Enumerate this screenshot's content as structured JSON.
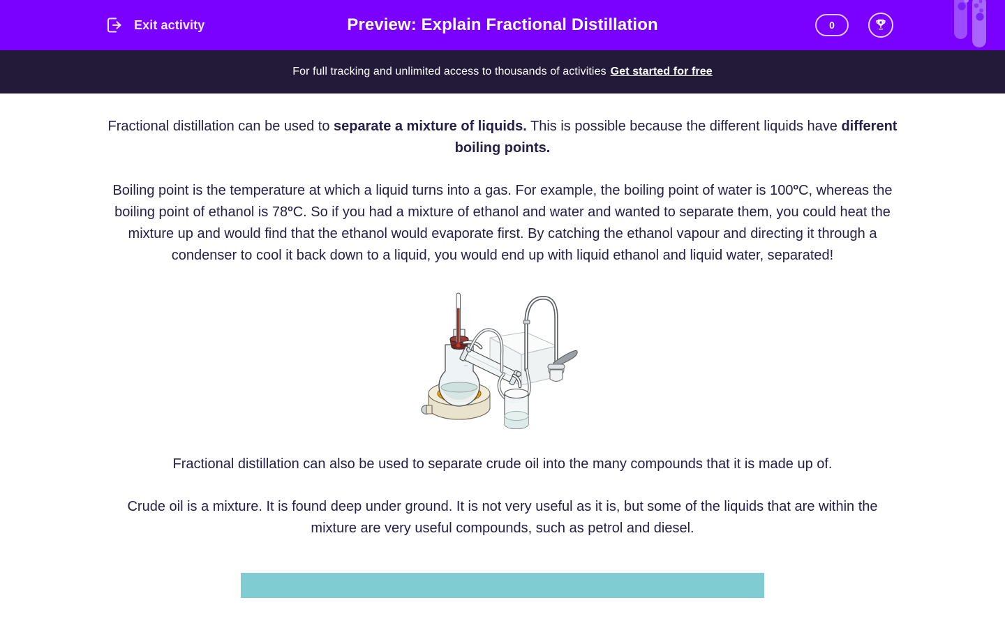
{
  "header": {
    "exit_label": "Exit activity",
    "exit_icon": "exit-arrow-icon",
    "title": "Preview: Explain Fractional Distillation",
    "points_value": "0",
    "trophy_icon": "trophy-icon",
    "decor_icon": "test-tubes-icon",
    "bg_color": "#7a00ff",
    "title_color": "#ffffff"
  },
  "promo": {
    "text": "For full tracking and unlimited access to thousands of activities",
    "cta": "Get started for free",
    "bg_color": "#221a38"
  },
  "body": {
    "p1": {
      "a": "Fractional distillation can be used to ",
      "b1": "separate a mixture of liquids.",
      "c": " This is possible because the different liquids have ",
      "b2": "different boiling points."
    },
    "p2": {
      "a": "Boiling point is the temperature at which a liquid turns into a gas. For example, the boiling point of water is 100",
      "sup1": "o",
      "b": "C, whereas the boiling point of ethanol is 78",
      "sup2": "o",
      "c": "C. So if you had a mixture of ethanol and water and wanted to separate them, you could heat the mixture up and would find that the ethanol would evaporate first. By catching the ethanol vapour and directing it through a condenser to cool it back down to a liquid, you would end up with liquid ethanol and liquid water, separated!"
    },
    "p3": "Fractional distillation can also be used to separate crude oil into the many compounds that it is made up of.",
    "p4": "Crude oil is a mixture. It is found deep under ground. It is not very useful as it is, but some of the liquids that are within the mixture are very useful compounds, such as petrol and diesel.",
    "text_color": "#25204a"
  },
  "figure": {
    "name": "fractional-distillation-apparatus-diagram",
    "parts": [
      "thermometer",
      "rubber-stopper",
      "round-bottom-flask",
      "heating-mantle",
      "condenser",
      "rubber-tubing",
      "sink-basin",
      "tap",
      "collection-beaker"
    ],
    "colors": {
      "glass": "#f4f6f7",
      "glass_outline": "#4a4a4a",
      "mantle": "#e9e2cd",
      "heat_coil": "#f5a623",
      "thermometer_liquid": "#c0392b",
      "stopper": "#7b2d2d",
      "liquid": "#dcebe9"
    }
  },
  "answer_bar": {
    "name": "answer-input-bar",
    "color": "#7fcdd3"
  }
}
